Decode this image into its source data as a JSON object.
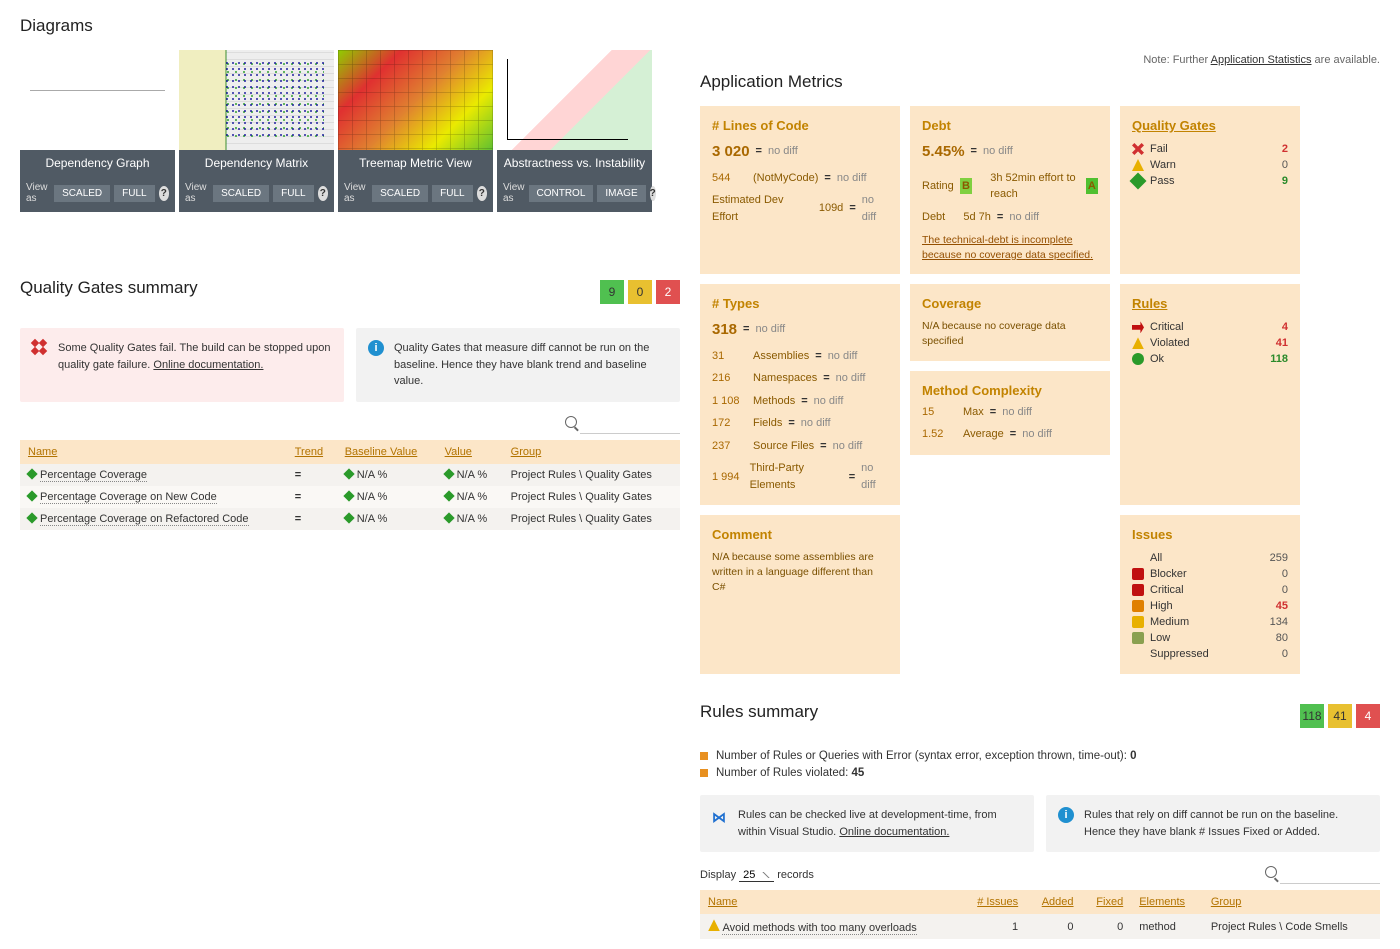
{
  "diagrams": {
    "heading": "Diagrams",
    "view_as": "View as",
    "cards": [
      {
        "title": "Dependency Graph",
        "btn1": "SCALED",
        "btn2": "FULL"
      },
      {
        "title": "Dependency Matrix",
        "btn1": "SCALED",
        "btn2": "FULL"
      },
      {
        "title": "Treemap Metric View",
        "btn1": "SCALED",
        "btn2": "FULL"
      },
      {
        "title": "Abstractness vs. Instability",
        "btn1": "CONTROL",
        "btn2": "IMAGE"
      },
      {
        "title": "",
        "btn1": "View as",
        "btn2": ""
      }
    ]
  },
  "metrics_note": {
    "prefix": "Note: Further ",
    "link": "Application Statistics",
    "suffix": " are available."
  },
  "metrics_heading": "Application Metrics",
  "loc": {
    "title": "# Lines of Code",
    "value": "3 020",
    "nodiff": "no diff",
    "notmycode_n": "544",
    "notmycode_lbl": "(NotMyCode)",
    "dev_lbl": "Estimated Dev Effort",
    "dev_val": "109d"
  },
  "debt": {
    "title": "Debt",
    "value": "5.45%",
    "nodiff": "no diff",
    "rating_lbl": "Rating",
    "rating_val": "B",
    "effort_lbl": "3h 52min effort to reach",
    "effort_target": "A",
    "debt_lbl": "Debt",
    "debt_val": "5d 7h",
    "warn": "The technical-debt is incomplete because no coverage data specified."
  },
  "types": {
    "title": "# Types",
    "value": "318",
    "nodiff": "no diff",
    "rows": [
      {
        "n": "31",
        "lbl": "Assemblies"
      },
      {
        "n": "216",
        "lbl": "Namespaces"
      },
      {
        "n": "1 108",
        "lbl": "Methods"
      },
      {
        "n": "172",
        "lbl": "Fields"
      },
      {
        "n": "237",
        "lbl": "Source Files"
      },
      {
        "n": "1 994",
        "lbl": "Third-Party Elements"
      }
    ]
  },
  "coverage": {
    "title": "Coverage",
    "text": "N/A because no coverage data specified"
  },
  "complexity": {
    "title": "Method Complexity",
    "rows": [
      {
        "n": "15",
        "lbl": "Max"
      },
      {
        "n": "1.52",
        "lbl": "Average"
      }
    ],
    "nodiff": "no diff"
  },
  "comment": {
    "title": "Comment",
    "text": "N/A because some assemblies are written in a language different than C#"
  },
  "gates": {
    "title": "Quality Gates",
    "rows": [
      {
        "ico": "fail",
        "lbl": "Fail",
        "val": "2",
        "cls": "red-num"
      },
      {
        "ico": "warn",
        "lbl": "Warn",
        "val": "0",
        "cls": "gray-num"
      },
      {
        "ico": "pass",
        "lbl": "Pass",
        "val": "9",
        "cls": "green-num"
      }
    ]
  },
  "rules": {
    "title": "Rules",
    "rows": [
      {
        "ico": "crit",
        "lbl": "Critical",
        "val": "4",
        "cls": "red-num"
      },
      {
        "ico": "viol",
        "lbl": "Violated",
        "val": "41",
        "cls": "red-num"
      },
      {
        "ico": "ok",
        "lbl": "Ok",
        "val": "118",
        "cls": "green-num"
      }
    ]
  },
  "issues": {
    "title": "Issues",
    "rows": [
      {
        "ico": "",
        "lbl": "All",
        "val": "259",
        "cls": "gray-num"
      },
      {
        "ico": "blocker",
        "lbl": "Blocker",
        "val": "0",
        "cls": "gray-num"
      },
      {
        "ico": "critical",
        "lbl": "Critical",
        "val": "0",
        "cls": "gray-num"
      },
      {
        "ico": "high",
        "lbl": "High",
        "val": "45",
        "cls": "red-num"
      },
      {
        "ico": "medium",
        "lbl": "Medium",
        "val": "134",
        "cls": "gray-num"
      },
      {
        "ico": "low",
        "lbl": "Low",
        "val": "80",
        "cls": "gray-num"
      },
      {
        "ico": "",
        "lbl": "Suppressed",
        "val": "0",
        "cls": "gray-num"
      }
    ]
  },
  "qg_summary": {
    "heading": "Quality Gates summary",
    "badges": [
      "9",
      "0",
      "2"
    ],
    "info1": "Some Quality Gates fail. The build can be stopped upon quality gate failure. ",
    "info1_link": "Online documentation.",
    "info2": "Quality Gates that measure diff cannot be run on the baseline. Hence they have blank trend and baseline value.",
    "th": [
      "Name",
      "Trend",
      "Baseline Value",
      "Value",
      "Group"
    ],
    "rows": [
      {
        "name": "Percentage Coverage",
        "trend": "=",
        "bv": "N/A %",
        "val": "N/A %",
        "grp": "Project Rules \\ Quality Gates"
      },
      {
        "name": "Percentage Coverage on New Code",
        "trend": "=",
        "bv": "N/A %",
        "val": "N/A %",
        "grp": "Project Rules \\ Quality Gates"
      },
      {
        "name": "Percentage Coverage on Refactored Code",
        "trend": "=",
        "bv": "N/A %",
        "val": "N/A %",
        "grp": "Project Rules \\ Quality Gates"
      }
    ]
  },
  "rules_summary": {
    "heading": "Rules summary",
    "badges": [
      "118",
      "41",
      "4"
    ],
    "bullet1_pre": "Number of Rules or Queries with Error (syntax error, exception thrown, time-out): ",
    "bullet1_val": "0",
    "bullet2_pre": "Number of Rules violated: ",
    "bullet2_val": "45",
    "info1": "Rules can be checked live at development-time, from within Visual Studio. ",
    "info1_link": "Online documentation.",
    "info2": "Rules that rely on diff cannot be run on the baseline. Hence they have blank # Issues Fixed or Added.",
    "display_lbl": "Display",
    "display_val": "25",
    "display_suffix": "records",
    "th": [
      "Name",
      "# Issues",
      "Added",
      "Fixed",
      "Elements",
      "Group"
    ],
    "rows": [
      {
        "name": "Avoid methods with too many overloads",
        "issues": "1",
        "added": "0",
        "fixed": "0",
        "elem": "method",
        "grp": "Project Rules \\ Code Smells"
      }
    ]
  }
}
